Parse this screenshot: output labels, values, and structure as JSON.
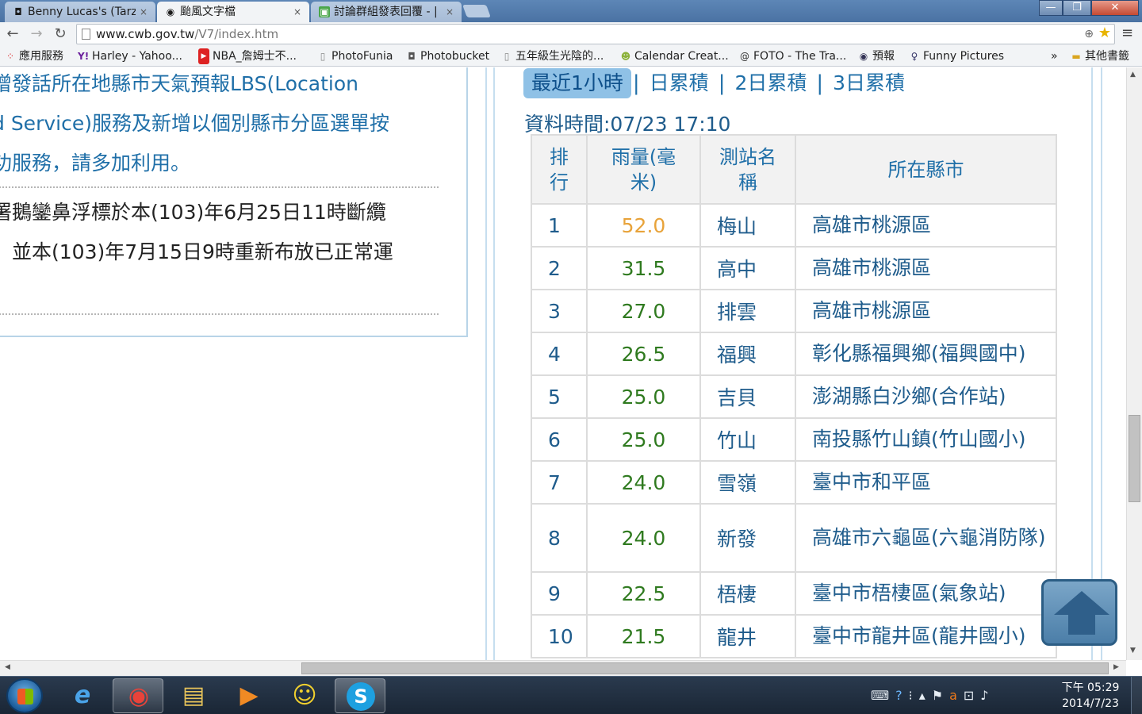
{
  "browser": {
    "tabs": [
      {
        "label": "Benny Lucas's (Tarz",
        "icon": "camera-icon",
        "close": "×"
      },
      {
        "label": "颱風文字檔",
        "icon": "eye-icon",
        "close": "×"
      },
      {
        "label": "討論群組發表回覆 - |",
        "icon": "green-forum-icon",
        "close": "×"
      }
    ],
    "window_buttons": {
      "minimize": "—",
      "maximize": "❐",
      "close": "✕"
    },
    "url_host": "www.cwb.gov.tw",
    "url_path": "/V7/index.htm",
    "bookmarks": [
      {
        "label": "應用服務",
        "icon": "apps-grid-icon"
      },
      {
        "label": "Harley - Yahoo...",
        "icon": "yahoo-icon"
      },
      {
        "label": "NBA_詹姆士不...",
        "icon": "youtube-icon"
      },
      {
        "label": "PhotoFunia",
        "icon": "page-icon"
      },
      {
        "label": "Photobucket",
        "icon": "camera-icon"
      },
      {
        "label": "五年級生光陰的...",
        "icon": "page-icon"
      },
      {
        "label": "Calendar Creat...",
        "icon": "smiley-icon"
      },
      {
        "label": "FOTO - The Tra...",
        "icon": "swirl-icon"
      },
      {
        "label": "預報",
        "icon": "eye-icon"
      },
      {
        "label": "Funny Pictures",
        "icon": "figure-icon"
      }
    ],
    "bookmarks_overflow": "»",
    "other_bookmarks": "其他書籤"
  },
  "page": {
    "announcements": {
      "line1": "增發話所在地縣市天氣預報LBS(Location",
      "line2": "d Service)服務及新增以個別縣市分區選單按",
      "line3": "功服務，請多加利用。",
      "line4": "署鵝鑾鼻浮標於本(103)年6月25日11時斷纜",
      "line5": "，並本(103)年7月15日9時重新布放已正常運"
    },
    "rain_tabs": [
      "最近1小時",
      "日累積",
      "2日累積",
      "3日累積"
    ],
    "rain_tab_separator": "|",
    "data_time": "資料時間:07/23 17:10",
    "table_headers": {
      "rank": "排\n行",
      "amount": "雨量(毫\n米)",
      "station": "測站名\n稱",
      "county": "所在縣市"
    },
    "rows": [
      {
        "rank": "1",
        "amount": "52.0",
        "station": "梅山",
        "county": "高雄市桃源區"
      },
      {
        "rank": "2",
        "amount": "31.5",
        "station": "高中",
        "county": "高雄市桃源區"
      },
      {
        "rank": "3",
        "amount": "27.0",
        "station": "排雲",
        "county": "高雄市桃源區"
      },
      {
        "rank": "4",
        "amount": "26.5",
        "station": "福興",
        "county": "彰化縣福興鄉(福興國中)"
      },
      {
        "rank": "5",
        "amount": "25.0",
        "station": "吉貝",
        "county": "澎湖縣白沙鄉(合作站)"
      },
      {
        "rank": "6",
        "amount": "25.0",
        "station": "竹山",
        "county": "南投縣竹山鎮(竹山國小)"
      },
      {
        "rank": "7",
        "amount": "24.0",
        "station": "雪嶺",
        "county": "臺中市和平區"
      },
      {
        "rank": "8",
        "amount": "24.0",
        "station": "新發",
        "county": "高雄市六龜區(六龜消防隊)"
      },
      {
        "rank": "9",
        "amount": "22.5",
        "station": "梧棲",
        "county": "臺中市梧棲區(氣象站)"
      },
      {
        "rank": "10",
        "amount": "21.5",
        "station": "龍井",
        "county": "臺中市龍井區(龍井國小)"
      }
    ]
  },
  "taskbar": {
    "items": [
      {
        "name": "internet-explorer-icon",
        "glyph": "e"
      },
      {
        "name": "chrome-icon",
        "glyph": "◉"
      },
      {
        "name": "folder-icon",
        "glyph": "▤"
      },
      {
        "name": "media-player-icon",
        "glyph": "▶"
      },
      {
        "name": "yahoo-messenger-icon",
        "glyph": "☺"
      },
      {
        "name": "skype-icon",
        "glyph": "S"
      }
    ],
    "clock_time": "下午 05:29",
    "clock_date": "2014/7/23"
  },
  "colors": {
    "accent_blue": "#1f6fa8",
    "value_green": "#2f7a1f",
    "value_orange": "#e8a33a"
  }
}
